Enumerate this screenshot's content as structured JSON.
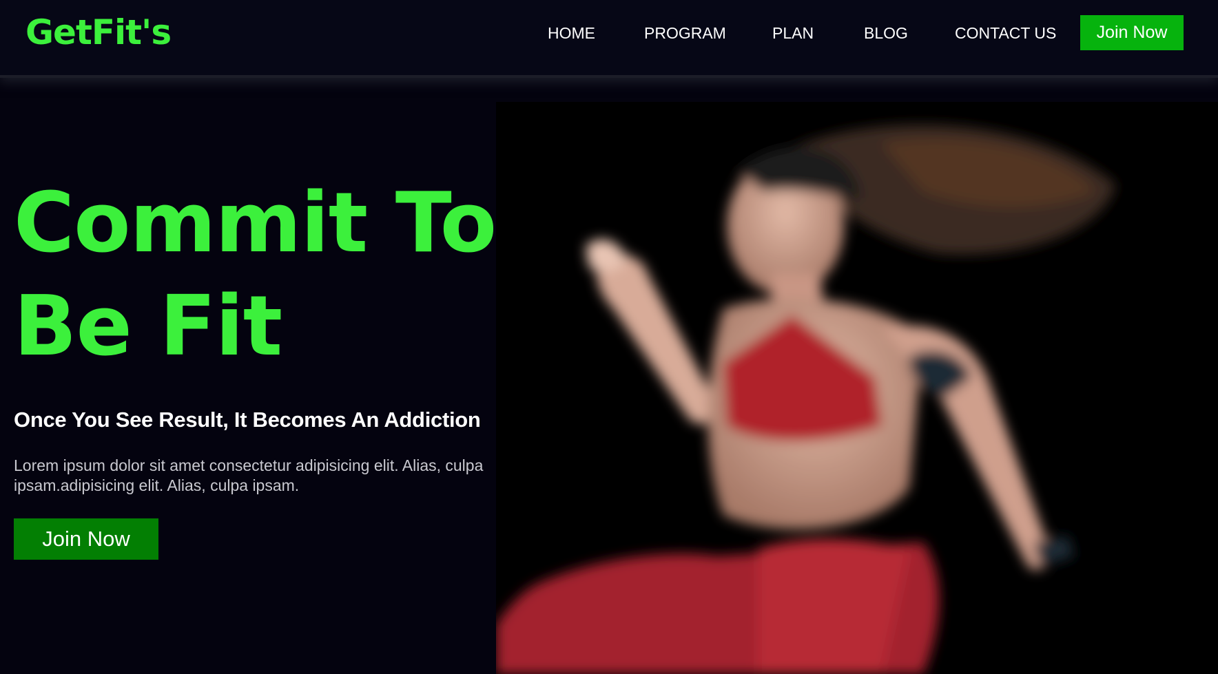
{
  "header": {
    "logo": "GetFit's",
    "nav": [
      {
        "label": "HOME"
      },
      {
        "label": "PROGRAM"
      },
      {
        "label": "PLAN"
      },
      {
        "label": "BLOG"
      },
      {
        "label": "CONTACT US"
      }
    ],
    "join_label": "Join Now"
  },
  "hero": {
    "title": "Commit To Be Fit",
    "subtitle": "Once You See Result, It Becomes An Addiction",
    "description": "Lorem ipsum dolor sit amet consectetur adipisicing elit. Alias, culpa ipsam.adipisicing elit. Alias, culpa ipsam.",
    "join_label": "Join Now",
    "image_icon": "athlete-photo"
  },
  "colors": {
    "background": "#04030f",
    "accent_green": "#3cf03c",
    "nav_button": "#06b30d",
    "hero_button": "#037f03"
  }
}
